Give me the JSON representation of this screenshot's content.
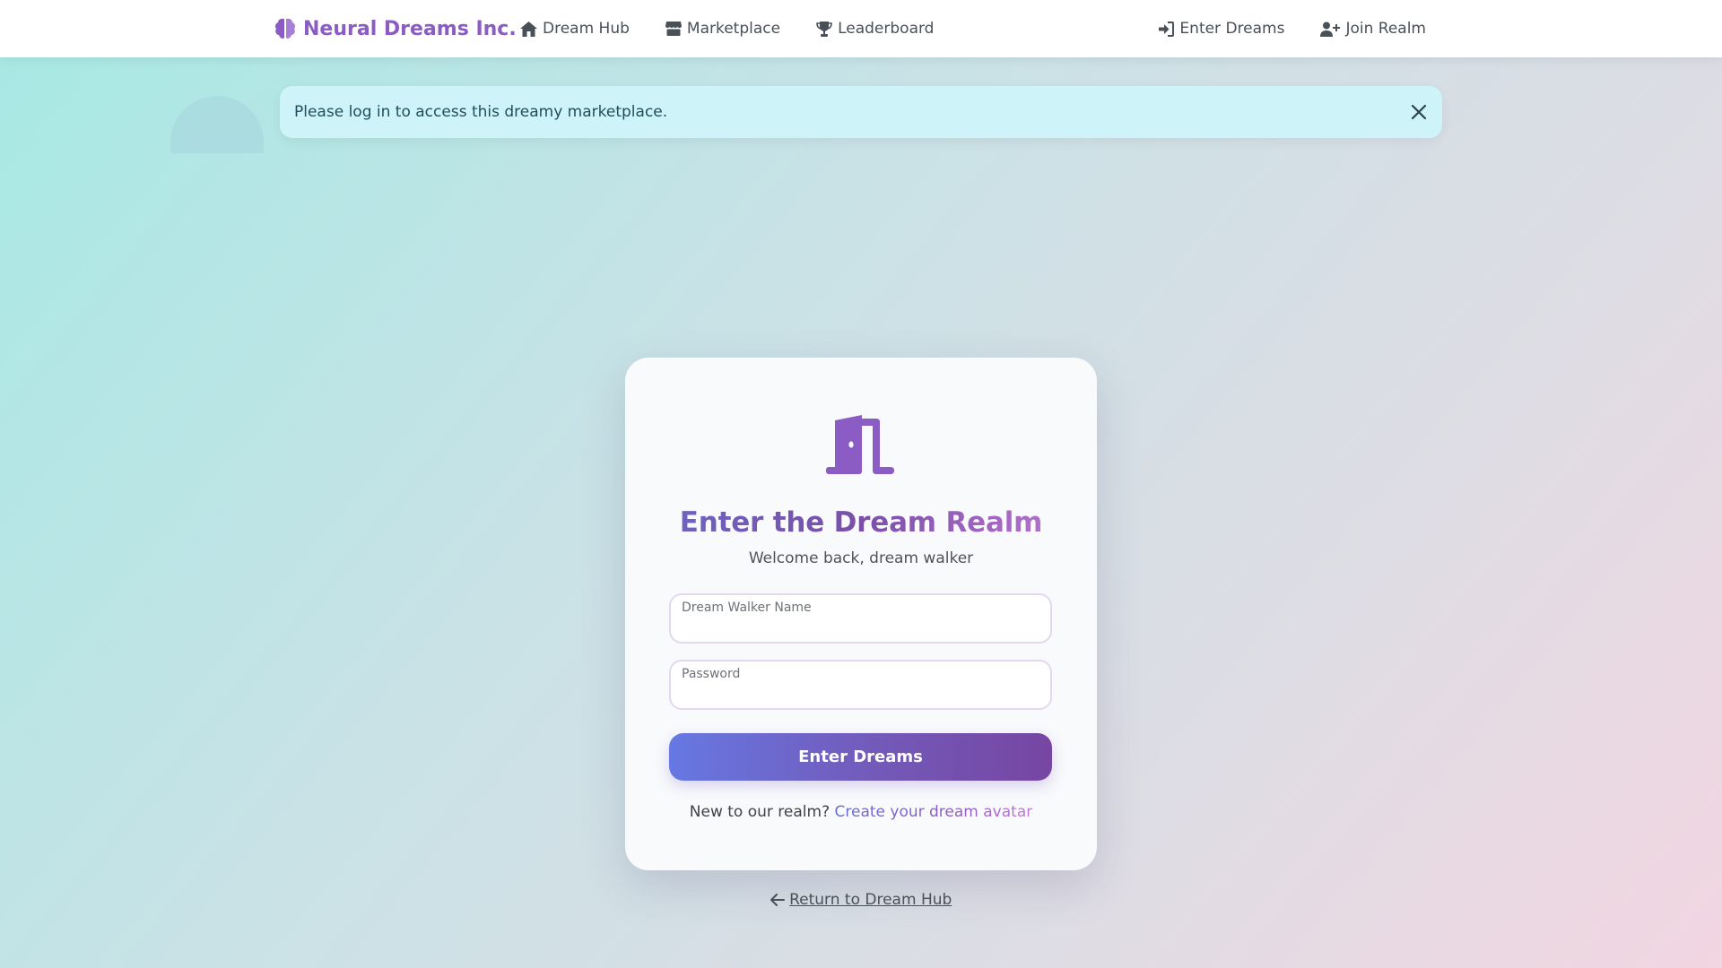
{
  "navbar": {
    "brand": "Neural Dreams Inc.",
    "brand_icon": "brain-icon",
    "links": [
      {
        "label": "Dream Hub",
        "icon": "home-icon"
      },
      {
        "label": "Marketplace",
        "icon": "store-icon"
      },
      {
        "label": "Leaderboard",
        "icon": "trophy-icon"
      }
    ],
    "auth": [
      {
        "label": "Enter Dreams",
        "icon": "sign-in-icon"
      },
      {
        "label": "Join Realm",
        "icon": "user-plus-icon"
      }
    ]
  },
  "alert": {
    "message": "Please log in to access this dreamy marketplace.",
    "close_icon": "close-icon"
  },
  "login": {
    "icon": "door-open-icon",
    "title": "Enter the Dream Realm",
    "subtitle": "Welcome back, dream walker",
    "username_label": "Dream Walker Name",
    "username_value": "",
    "password_label": "Password",
    "password_value": "",
    "submit_label": "Enter Dreams",
    "register_prompt": "New to our realm?",
    "register_link": "Create your dream avatar"
  },
  "back_link": "Return to Dream Hub",
  "colors": {
    "brand": "#8a5cc4",
    "button_start": "#6678e2",
    "button_end": "#7646a2",
    "alert_bg": "#cef3f8"
  }
}
